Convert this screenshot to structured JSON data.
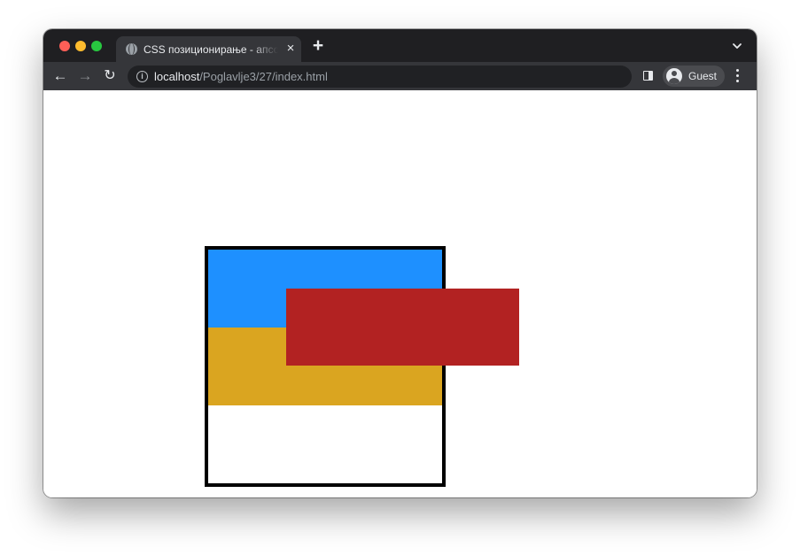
{
  "window": {
    "tab": {
      "title": "CSS позиционирање - апсолутно",
      "close_symbol": "×"
    },
    "new_tab_symbol": "+",
    "toolbar": {
      "back_symbol": "←",
      "forward_symbol": "→",
      "reload_symbol": "↻",
      "info_symbol": "i",
      "url_host": "localhost",
      "url_path": "/Poglavlje3/27/index.html",
      "profile_name": "Guest"
    }
  },
  "page": {
    "blocks": [
      {
        "name": "blue-block",
        "color": "#1e90ff"
      },
      {
        "name": "gold-block",
        "color": "#daa520"
      },
      {
        "name": "red-block",
        "color": "#b22222"
      }
    ],
    "container_border_color": "#000000"
  }
}
